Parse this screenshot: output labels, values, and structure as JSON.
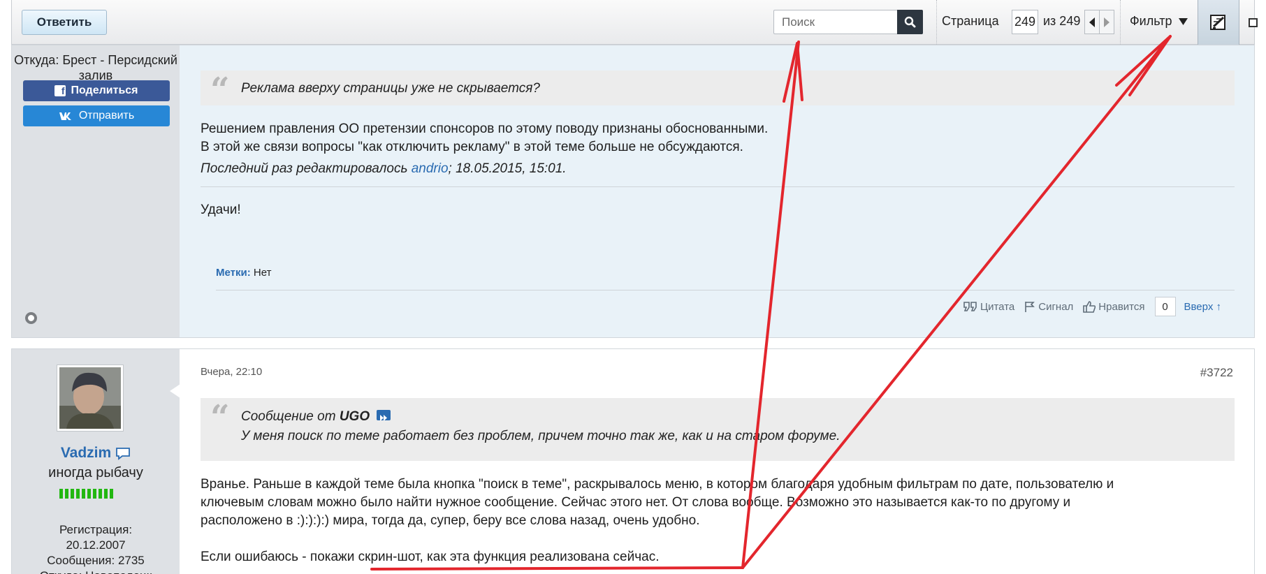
{
  "toolbar": {
    "reply_label": "Ответить",
    "search_placeholder": "Поиск",
    "page_label": "Страница",
    "page_current": "249",
    "page_of_label": "из 249",
    "filter_label": "Фильтр"
  },
  "post1": {
    "user": {
      "location": "Откуда: Брест - Персидский залив",
      "share_facebook": "Поделиться",
      "share_vk": "Отправить"
    },
    "quote_text": "Реклама вверху страницы уже не скрывается?",
    "body_line1": "Решением правления ОО претензии спонсоров по этому поводу признаны обоснованными.",
    "body_line2": "В этой же связи вопросы \"как отключить рекламу\" в этой теме больше не обсуждаются.",
    "edited_prefix": "Последний раз редактировалось ",
    "edited_user": "andrio",
    "edited_suffix": "; 18.05.2015, 15:01.",
    "closing": "Удачи!",
    "tags_label": "Метки:",
    "tags_value": "Нет",
    "actions": {
      "quote": "Цитата",
      "report": "Сигнал",
      "like": "Нравится",
      "like_count": "0",
      "top": "Вверх ↑"
    }
  },
  "post2": {
    "user": {
      "name": "Vadzim",
      "title": "иногда рыбачу",
      "registration_label": "Регистрация:",
      "registration_date": "20.12.2007",
      "messages": "Сообщения: 2735",
      "location": "Откуда: Новополоцк"
    },
    "date": "Вчера, 22:10",
    "number": "#3722",
    "quote_from": "Сообщение от",
    "quote_author": "UGO",
    "quote_text": "У меня поиск по теме работает без проблем, причем точно так же, как и на старом форуме.",
    "body_line1": "Вранье. Раньше в каждой теме была кнопка \"поиск в теме\", раскрывалось меню, в котором благодаря удобным фильтрам по дате, пользователю и",
    "body_line2": "ключевым словам можно было найти нужное сообщение. Сейчас этого нет. От слова вообще. Возможно это называется как-то по другому и",
    "body_line3": "расположено в :):):):) мира, тогда да, супер, беру все слова назад, очень удобно.",
    "body_line4": "Если ошибаюсь - покажи скрин-шот, как эта функция реализована сейчас."
  },
  "colors": {
    "accent_link": "#2a6bb1",
    "annotation": "#e3262d",
    "facebook": "#3b5998",
    "vk": "#2787d6"
  }
}
